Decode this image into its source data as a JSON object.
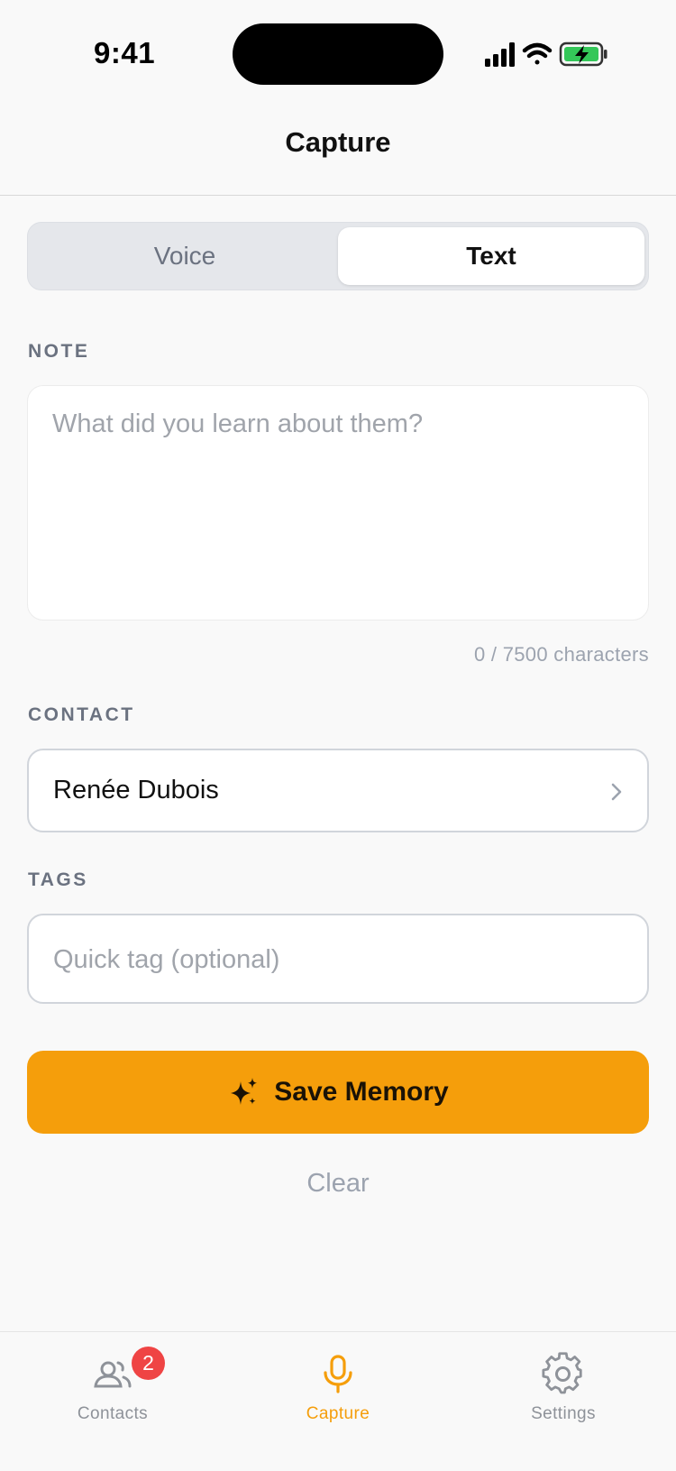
{
  "status_bar": {
    "time": "9:41",
    "icons": [
      "cellular-signal-icon",
      "wifi-icon",
      "battery-charging-icon"
    ]
  },
  "nav": {
    "title": "Capture"
  },
  "mode_switch": {
    "options": [
      "Voice",
      "Text"
    ],
    "selected": "Text"
  },
  "note": {
    "label": "NOTE",
    "value": "",
    "placeholder": "What did you learn about them?",
    "char_count": "0 / 7500 characters"
  },
  "contact": {
    "label": "CONTACT",
    "value": "Renée Dubois"
  },
  "tags": {
    "label": "TAGS",
    "placeholder": "Quick tag (optional)"
  },
  "actions": {
    "save_label": "Save Memory",
    "clear_label": "Clear"
  },
  "tab_bar": {
    "items": [
      {
        "label": "Contacts",
        "icon": "contacts-icon",
        "badge": "2"
      },
      {
        "label": "Capture",
        "icon": "microphone-icon",
        "active": true
      },
      {
        "label": "Settings",
        "icon": "gear-icon"
      }
    ]
  },
  "colors": {
    "accent": "#f59e0b",
    "badge": "#ef4444",
    "battery": "#34c759"
  }
}
